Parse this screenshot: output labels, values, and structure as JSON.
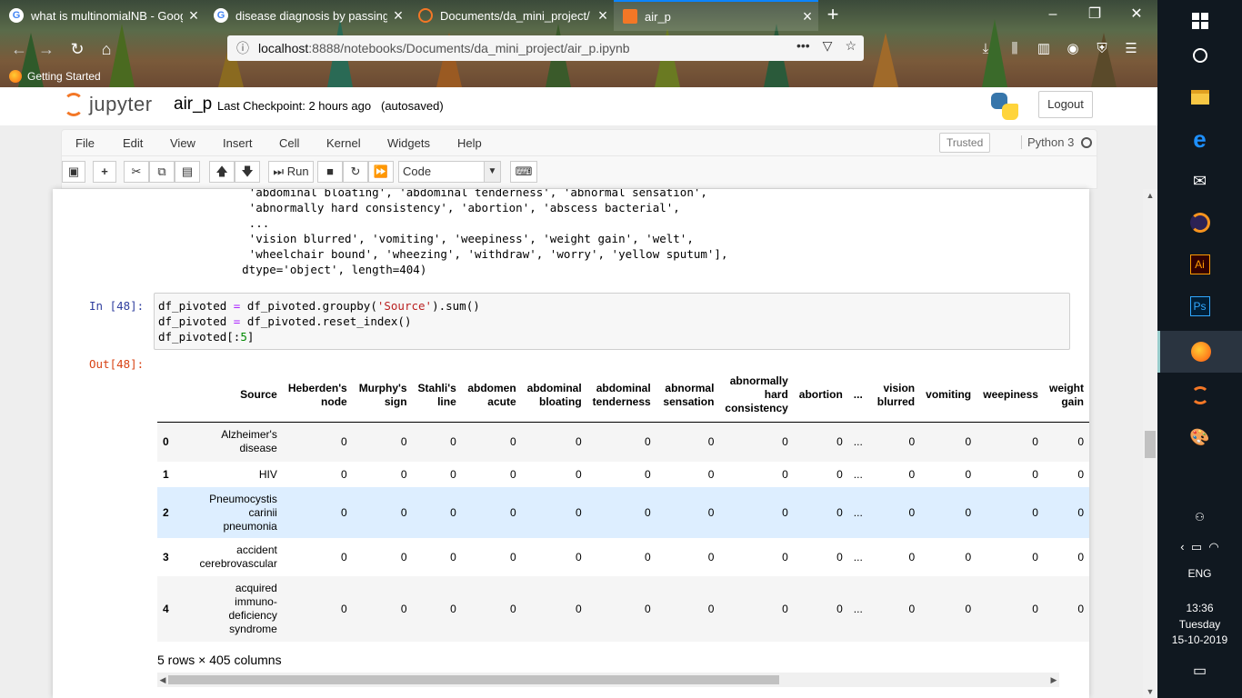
{
  "browser": {
    "tabs": [
      {
        "title": "what is multinomialNB - Goog",
        "icon": "google-icon",
        "active": false
      },
      {
        "title": "disease diagnosis by passing sy",
        "icon": "google-icon",
        "active": false
      },
      {
        "title": "Documents/da_mini_project/",
        "icon": "jupyter-icon",
        "active": false
      },
      {
        "title": "air_p",
        "icon": "jupyter-icon",
        "active": true
      }
    ],
    "url_host": "localhost",
    "url_path": ":8888/notebooks/Documents/da_mini_project/air_p.ipynb",
    "bookmark": "Getting Started"
  },
  "jupyter": {
    "logo_text": "jupyter",
    "notebook_name": "air_p",
    "checkpoint": "Last Checkpoint: 2 hours ago",
    "autosaved": "(autosaved)",
    "logout": "Logout",
    "menus": [
      "File",
      "Edit",
      "View",
      "Insert",
      "Cell",
      "Kernel",
      "Widgets",
      "Help"
    ],
    "trusted": "Trusted",
    "kernel": "Python 3",
    "toolbar": {
      "run_label": "Run",
      "cell_type": "Code"
    }
  },
  "prev_output": [
    "       'abdominal bloating', 'abdominal tenderness', 'abnormal sensation',",
    "       'abnormally hard consistency', 'abortion', 'abscess bacterial',",
    "       ...",
    "       'vision blurred', 'vomiting', 'weepiness', 'weight gain', 'welt',",
    "       'wheelchair bound', 'wheezing', 'withdraw', 'worry', 'yellow sputum'],",
    "      dtype='object', length=404)"
  ],
  "cell": {
    "in_prompt": "In [48]:",
    "out_prompt": "Out[48]:",
    "code_line1_a": "df_pivoted ",
    "code_line1_op": "=",
    "code_line1_b": " df_pivoted.groupby(",
    "code_line1_str": "'Source'",
    "code_line1_c": ").sum()",
    "code_line2_a": "df_pivoted ",
    "code_line2_op": "=",
    "code_line2_b": " df_pivoted.reset_index()",
    "code_line3_a": "df_pivoted[:",
    "code_line3_num": "5",
    "code_line3_b": "]"
  },
  "table": {
    "columns": [
      "Source",
      "Heberden's node",
      "Murphy's sign",
      "Stahli's line",
      "abdomen acute",
      "abdominal bloating",
      "abdominal tenderness",
      "abnormal sensation",
      "abnormally hard consistency",
      "abortion",
      "...",
      "vision blurred",
      "vomiting",
      "weepiness",
      "weight gain"
    ],
    "rows": [
      {
        "index": "0",
        "source": "Alzheimer's disease",
        "values": [
          "0",
          "0",
          "0",
          "0",
          "0",
          "0",
          "0",
          "0",
          "0",
          "...",
          "0",
          "0",
          "0",
          "0"
        ]
      },
      {
        "index": "1",
        "source": "HIV",
        "values": [
          "0",
          "0",
          "0",
          "0",
          "0",
          "0",
          "0",
          "0",
          "0",
          "...",
          "0",
          "0",
          "0",
          "0"
        ]
      },
      {
        "index": "2",
        "source": "Pneumocystis carinii pneumonia",
        "values": [
          "0",
          "0",
          "0",
          "0",
          "0",
          "0",
          "0",
          "0",
          "0",
          "...",
          "0",
          "0",
          "0",
          "0"
        ]
      },
      {
        "index": "3",
        "source": "accident cerebrovascular",
        "values": [
          "0",
          "0",
          "0",
          "0",
          "0",
          "0",
          "0",
          "0",
          "0",
          "...",
          "0",
          "0",
          "0",
          "0"
        ]
      },
      {
        "index": "4",
        "source": "acquired immuno-deficiency syndrome",
        "values": [
          "0",
          "0",
          "0",
          "0",
          "0",
          "0",
          "0",
          "0",
          "0",
          "...",
          "0",
          "0",
          "0",
          "0"
        ]
      }
    ],
    "summary": "5 rows × 405 columns"
  },
  "taskbar": {
    "language": "ENG",
    "time": "13:36",
    "day": "Tuesday",
    "date": "15-10-2019"
  }
}
